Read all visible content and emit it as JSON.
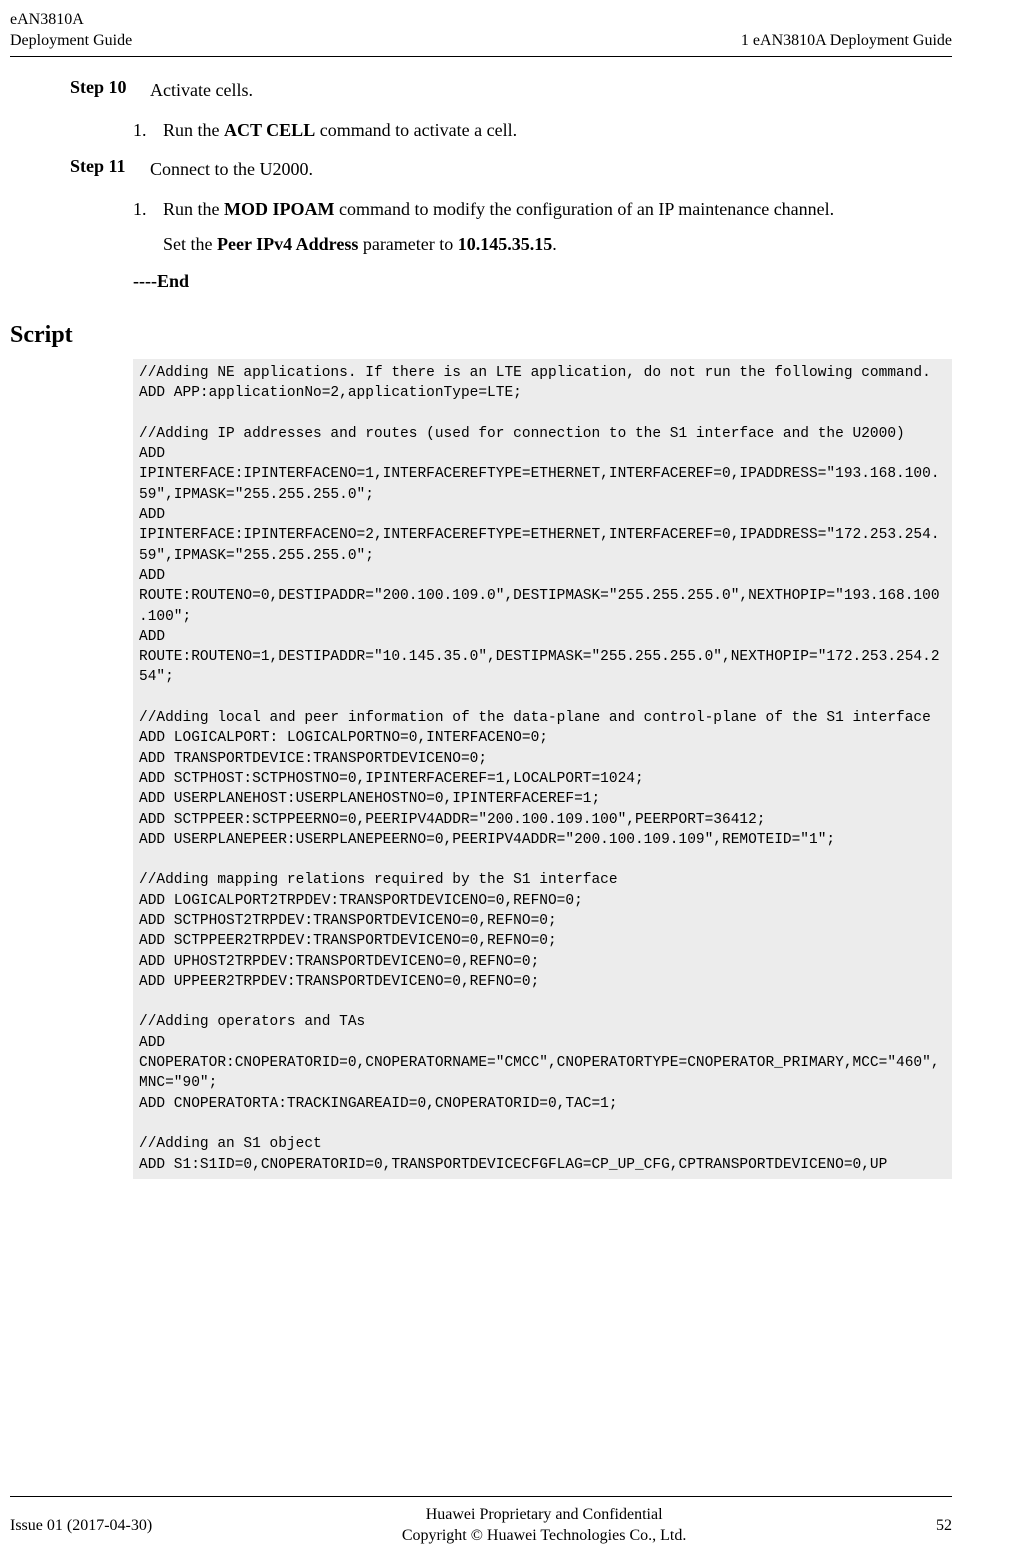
{
  "header": {
    "left_line1": "eAN3810A",
    "left_line2": "Deployment Guide",
    "right": "1 eAN3810A Deployment Guide"
  },
  "steps": {
    "s10": {
      "label": "Step 10",
      "text": "Activate cells.",
      "ol1_num": "1.",
      "ol1_p1": "Run the ",
      "ol1_b1": "ACT CELL",
      "ol1_p2": " command to activate a cell."
    },
    "s11": {
      "label": "Step 11",
      "text": "Connect to the U2000.",
      "ol1_num": "1.",
      "ol1_p1": "Run the ",
      "ol1_b1": "MOD IPOAM",
      "ol1_p2": " command to modify the configuration of an IP maintenance channel.",
      "line2_p1": "Set the ",
      "line2_b1": "Peer IPv4 Address",
      "line2_p2": " parameter to ",
      "line2_b2": "10.145.35.15",
      "line2_p3": "."
    },
    "end": "----End"
  },
  "script_heading": "Script",
  "code": "//Adding NE applications. If there is an LTE application, do not run the following command.\nADD APP:applicationNo=2,applicationType=LTE;\n\n//Adding IP addresses and routes (used for connection to the S1 interface and the U2000)\nADD IPINTERFACE:IPINTERFACENO=1,INTERFACEREFTYPE=ETHERNET,INTERFACEREF=0,IPADDRESS=\"193.168.100.59\",IPMASK=\"255.255.255.0\";\nADD IPINTERFACE:IPINTERFACENO=2,INTERFACEREFTYPE=ETHERNET,INTERFACEREF=0,IPADDRESS=\"172.253.254.59\",IPMASK=\"255.255.255.0\";\nADD ROUTE:ROUTENO=0,DESTIPADDR=\"200.100.109.0\",DESTIPMASK=\"255.255.255.0\",NEXTHOPIP=\"193.168.100.100\";\nADD ROUTE:ROUTENO=1,DESTIPADDR=\"10.145.35.0\",DESTIPMASK=\"255.255.255.0\",NEXTHOPIP=\"172.253.254.254\";\n\n//Adding local and peer information of the data-plane and control-plane of the S1 interface\nADD LOGICALPORT: LOGICALPORTNO=0,INTERFACENO=0;\nADD TRANSPORTDEVICE:TRANSPORTDEVICENO=0;\nADD SCTPHOST:SCTPHOSTNO=0,IPINTERFACEREF=1,LOCALPORT=1024;\nADD USERPLANEHOST:USERPLANEHOSTNO=0,IPINTERFACEREF=1;\nADD SCTPPEER:SCTPPEERNO=0,PEERIPV4ADDR=\"200.100.109.100\",PEERPORT=36412;\nADD USERPLANEPEER:USERPLANEPEERNO=0,PEERIPV4ADDR=\"200.100.109.109\",REMOTEID=\"1\";\n\n//Adding mapping relations required by the S1 interface\nADD LOGICALPORT2TRPDEV:TRANSPORTDEVICENO=0,REFNO=0;\nADD SCTPHOST2TRPDEV:TRANSPORTDEVICENO=0,REFNO=0;\nADD SCTPPEER2TRPDEV:TRANSPORTDEVICENO=0,REFNO=0;\nADD UPHOST2TRPDEV:TRANSPORTDEVICENO=0,REFNO=0;\nADD UPPEER2TRPDEV:TRANSPORTDEVICENO=0,REFNO=0;\n\n//Adding operators and TAs\nADD CNOPERATOR:CNOPERATORID=0,CNOPERATORNAME=\"CMCC\",CNOPERATORTYPE=CNOPERATOR_PRIMARY,MCC=\"460\",MNC=\"90\";\nADD CNOPERATORTA:TRACKINGAREAID=0,CNOPERATORID=0,TAC=1;\n\n//Adding an S1 object\nADD S1:S1ID=0,CNOPERATORID=0,TRANSPORTDEVICECFGFLAG=CP_UP_CFG,CPTRANSPORTDEVICENO=0,UP",
  "footer": {
    "left": "Issue 01 (2017-04-30)",
    "center_line1": "Huawei Proprietary and Confidential",
    "center_line2": "Copyright © Huawei Technologies Co., Ltd.",
    "right": "52"
  }
}
